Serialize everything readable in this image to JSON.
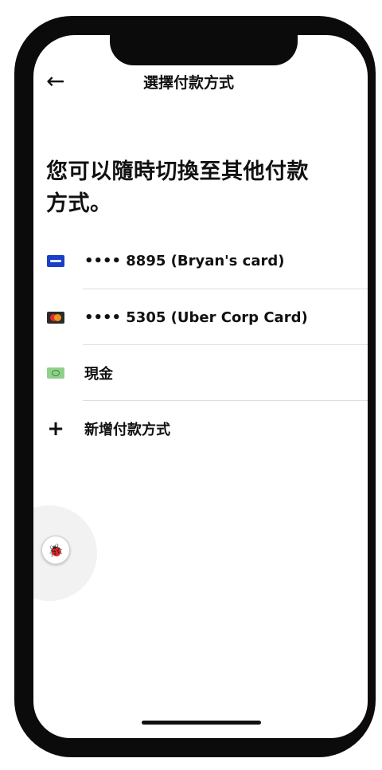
{
  "header": {
    "title": "選擇付款方式"
  },
  "headline": {
    "line1": "您可以隨時切換至其他付款",
    "line2": "方式。"
  },
  "payment_options": [
    {
      "label": "•••• 8895 (Bryan's card)",
      "icon": "visa-card-icon"
    },
    {
      "label": "•••• 5305 (Uber Corp Card)",
      "icon": "mastercard-icon"
    },
    {
      "label": "現金",
      "icon": "cash-icon"
    },
    {
      "label": "新增付款方式",
      "icon": "plus-icon"
    }
  ],
  "colors": {
    "visa": "#1a3fc6",
    "mastercard_red": "#e52d27",
    "mastercard_orange": "#f7a11a",
    "cash": "#8fd18a"
  }
}
